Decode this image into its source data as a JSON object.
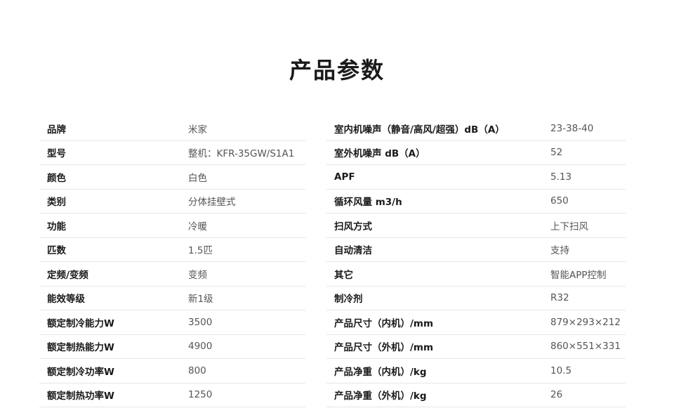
{
  "title": "产品参数",
  "left_params": [
    {
      "key": "品牌",
      "value": "米家"
    },
    {
      "key": "型号",
      "value": "整机：KFR-35GW/S1A1"
    },
    {
      "key": "颜色",
      "value": "白色"
    },
    {
      "key": "类别",
      "value": "分体挂壁式"
    },
    {
      "key": "功能",
      "value": "冷暖"
    },
    {
      "key": "匹数",
      "value": "1.5匹"
    },
    {
      "key": "定频/变频",
      "value": "变频"
    },
    {
      "key": "能效等级",
      "value": "新1级"
    },
    {
      "key": "额定制冷能力W",
      "value": "3500"
    },
    {
      "key": "额定制热能力W",
      "value": "4900"
    },
    {
      "key": "额定制冷功率W",
      "value": "800"
    },
    {
      "key": "额定制热功率W",
      "value": "1250"
    }
  ],
  "right_params": [
    {
      "key": "室内机噪声（静音/高风/超强）dB（A）",
      "value": "23-38-40"
    },
    {
      "key": "室外机噪声 dB（A）",
      "value": "52"
    },
    {
      "key": "APF",
      "value": "5.13"
    },
    {
      "key": "循环风量 m3/h",
      "value": "650"
    },
    {
      "key": "扫风方式",
      "value": "上下扫风"
    },
    {
      "key": "自动清洁",
      "value": "支持"
    },
    {
      "key": "其它",
      "value": "智能APP控制"
    },
    {
      "key": "制冷剂",
      "value": "R32"
    },
    {
      "key": "产品尺寸（内机）/mm",
      "value": "879×293×212"
    },
    {
      "key": "产品尺寸（外机）/mm",
      "value": "860×551×331"
    },
    {
      "key": "产品净重（内机）/kg",
      "value": "10.5"
    },
    {
      "key": "产品净重（外机）/kg",
      "value": "26"
    }
  ]
}
